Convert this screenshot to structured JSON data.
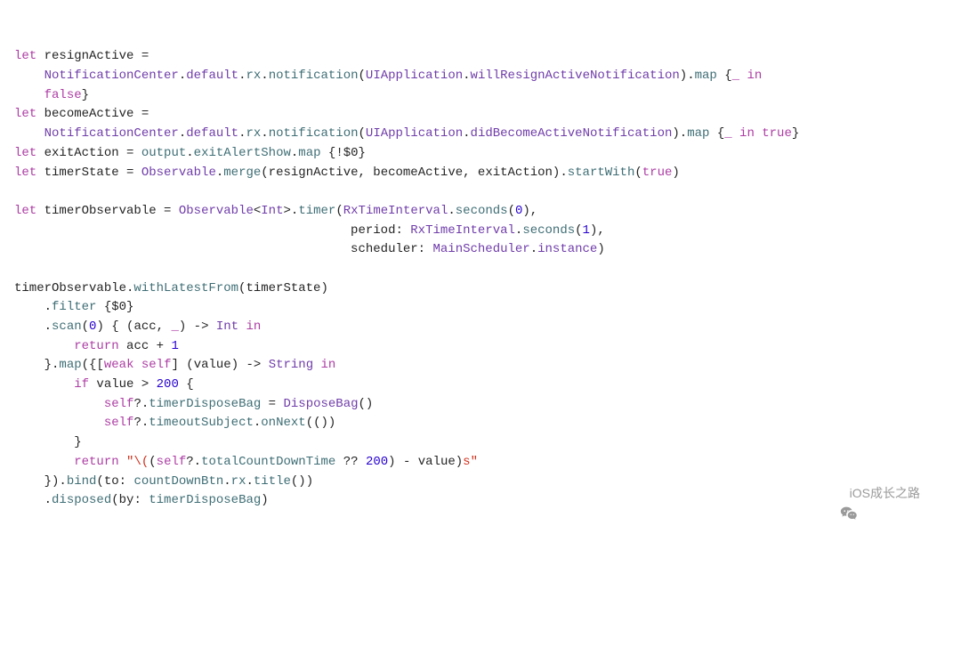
{
  "watermark": {
    "text": "iOS成长之路"
  },
  "code": {
    "l1": {
      "t0": "let",
      "t1": " resignActive ="
    },
    "l2": {
      "t0": "    ",
      "t1": "NotificationCenter",
      "t2": ".",
      "t3": "default",
      "t4": ".",
      "t5": "rx",
      "t6": ".",
      "t7": "notification",
      "t8": "(",
      "t9": "UIApplication",
      "t10": ".",
      "t11": "willResignActiveNotification",
      "t12": ").",
      "t13": "map",
      "t14": " {",
      "t15": "_ in"
    },
    "l3": {
      "t0": "    ",
      "t1": "false",
      "t2": "}"
    },
    "l4": {
      "t0": "let",
      "t1": " becomeActive ="
    },
    "l5": {
      "t0": "    ",
      "t1": "NotificationCenter",
      "t2": ".",
      "t3": "default",
      "t4": ".",
      "t5": "rx",
      "t6": ".",
      "t7": "notification",
      "t8": "(",
      "t9": "UIApplication",
      "t10": ".",
      "t11": "didBecomeActiveNotification",
      "t12": ").",
      "t13": "map",
      "t14": " {",
      "t15": "_ in",
      "t16": " ",
      "t17": "true",
      "t18": "}"
    },
    "l6": {
      "t0": "let",
      "t1": " exitAction = ",
      "t2": "output",
      "t3": ".",
      "t4": "exitAlertShow",
      "t5": ".",
      "t6": "map",
      "t7": " {!$0}"
    },
    "l7": {
      "t0": "let",
      "t1": " timerState = ",
      "t2": "Observable",
      "t3": ".",
      "t4": "merge",
      "t5": "(resignActive, becomeActive, exitAction).",
      "t6": "startWith",
      "t7": "(",
      "t8": "true",
      "t9": ")"
    },
    "l8": {
      "t0": ""
    },
    "l9": {
      "t0": "let",
      "t1": " timerObservable = ",
      "t2": "Observable",
      "t3": "<",
      "t4": "Int",
      "t5": ">.",
      "t6": "timer",
      "t7": "(",
      "t8": "RxTimeInterval",
      "t9": ".",
      "t10": "seconds",
      "t11": "(",
      "t12": "0",
      "t13": "),"
    },
    "l10": {
      "t0": "                                             period: ",
      "t1": "RxTimeInterval",
      "t2": ".",
      "t3": "seconds",
      "t4": "(",
      "t5": "1",
      "t6": "),"
    },
    "l11": {
      "t0": "                                             scheduler: ",
      "t1": "MainScheduler",
      "t2": ".",
      "t3": "instance",
      "t4": ")"
    },
    "l12": {
      "t0": ""
    },
    "l13": {
      "t0": "timerObservable.",
      "t1": "withLatestFrom",
      "t2": "(timerState)"
    },
    "l14": {
      "t0": "    .",
      "t1": "filter",
      "t2": " {$0}"
    },
    "l15": {
      "t0": "    .",
      "t1": "scan",
      "t2": "(",
      "t3": "0",
      "t4": ") { (acc, ",
      "t5": "_",
      "t6": ") -> ",
      "t7": "Int",
      "t8": " ",
      "t9": "in"
    },
    "l16": {
      "t0": "        ",
      "t1": "return",
      "t2": " acc + ",
      "t3": "1"
    },
    "l17": {
      "t0": "    }.",
      "t1": "map",
      "t2": "({[",
      "t3": "weak",
      "t4": " ",
      "t5": "self",
      "t6": "] (value) -> ",
      "t7": "String",
      "t8": " ",
      "t9": "in"
    },
    "l18": {
      "t0": "        ",
      "t1": "if",
      "t2": " value > ",
      "t3": "200",
      "t4": " {"
    },
    "l19": {
      "t0": "            ",
      "t1": "self",
      "t2": "?.",
      "t3": "timerDisposeBag",
      "t4": " = ",
      "t5": "DisposeBag",
      "t6": "()"
    },
    "l20": {
      "t0": "            ",
      "t1": "self",
      "t2": "?.",
      "t3": "timeoutSubject",
      "t4": ".",
      "t5": "onNext",
      "t6": "(())"
    },
    "l21": {
      "t0": "        }"
    },
    "l22": {
      "t0": "        ",
      "t1": "return",
      "t2": " ",
      "t3": "\"\\(",
      "t4": "(",
      "t5": "self",
      "t6": "?.",
      "t7": "totalCountDownTime",
      "t8": " ?? ",
      "t9": "200",
      "t10": ") - value)",
      "t11": "s\""
    },
    "l23": {
      "t0": "    }).",
      "t1": "bind",
      "t2": "(to: ",
      "t3": "countDownBtn",
      "t4": ".",
      "t5": "rx",
      "t6": ".",
      "t7": "title",
      "t8": "())"
    },
    "l24": {
      "t0": "    .",
      "t1": "disposed",
      "t2": "(by: ",
      "t3": "timerDisposeBag",
      "t4": ")"
    }
  }
}
